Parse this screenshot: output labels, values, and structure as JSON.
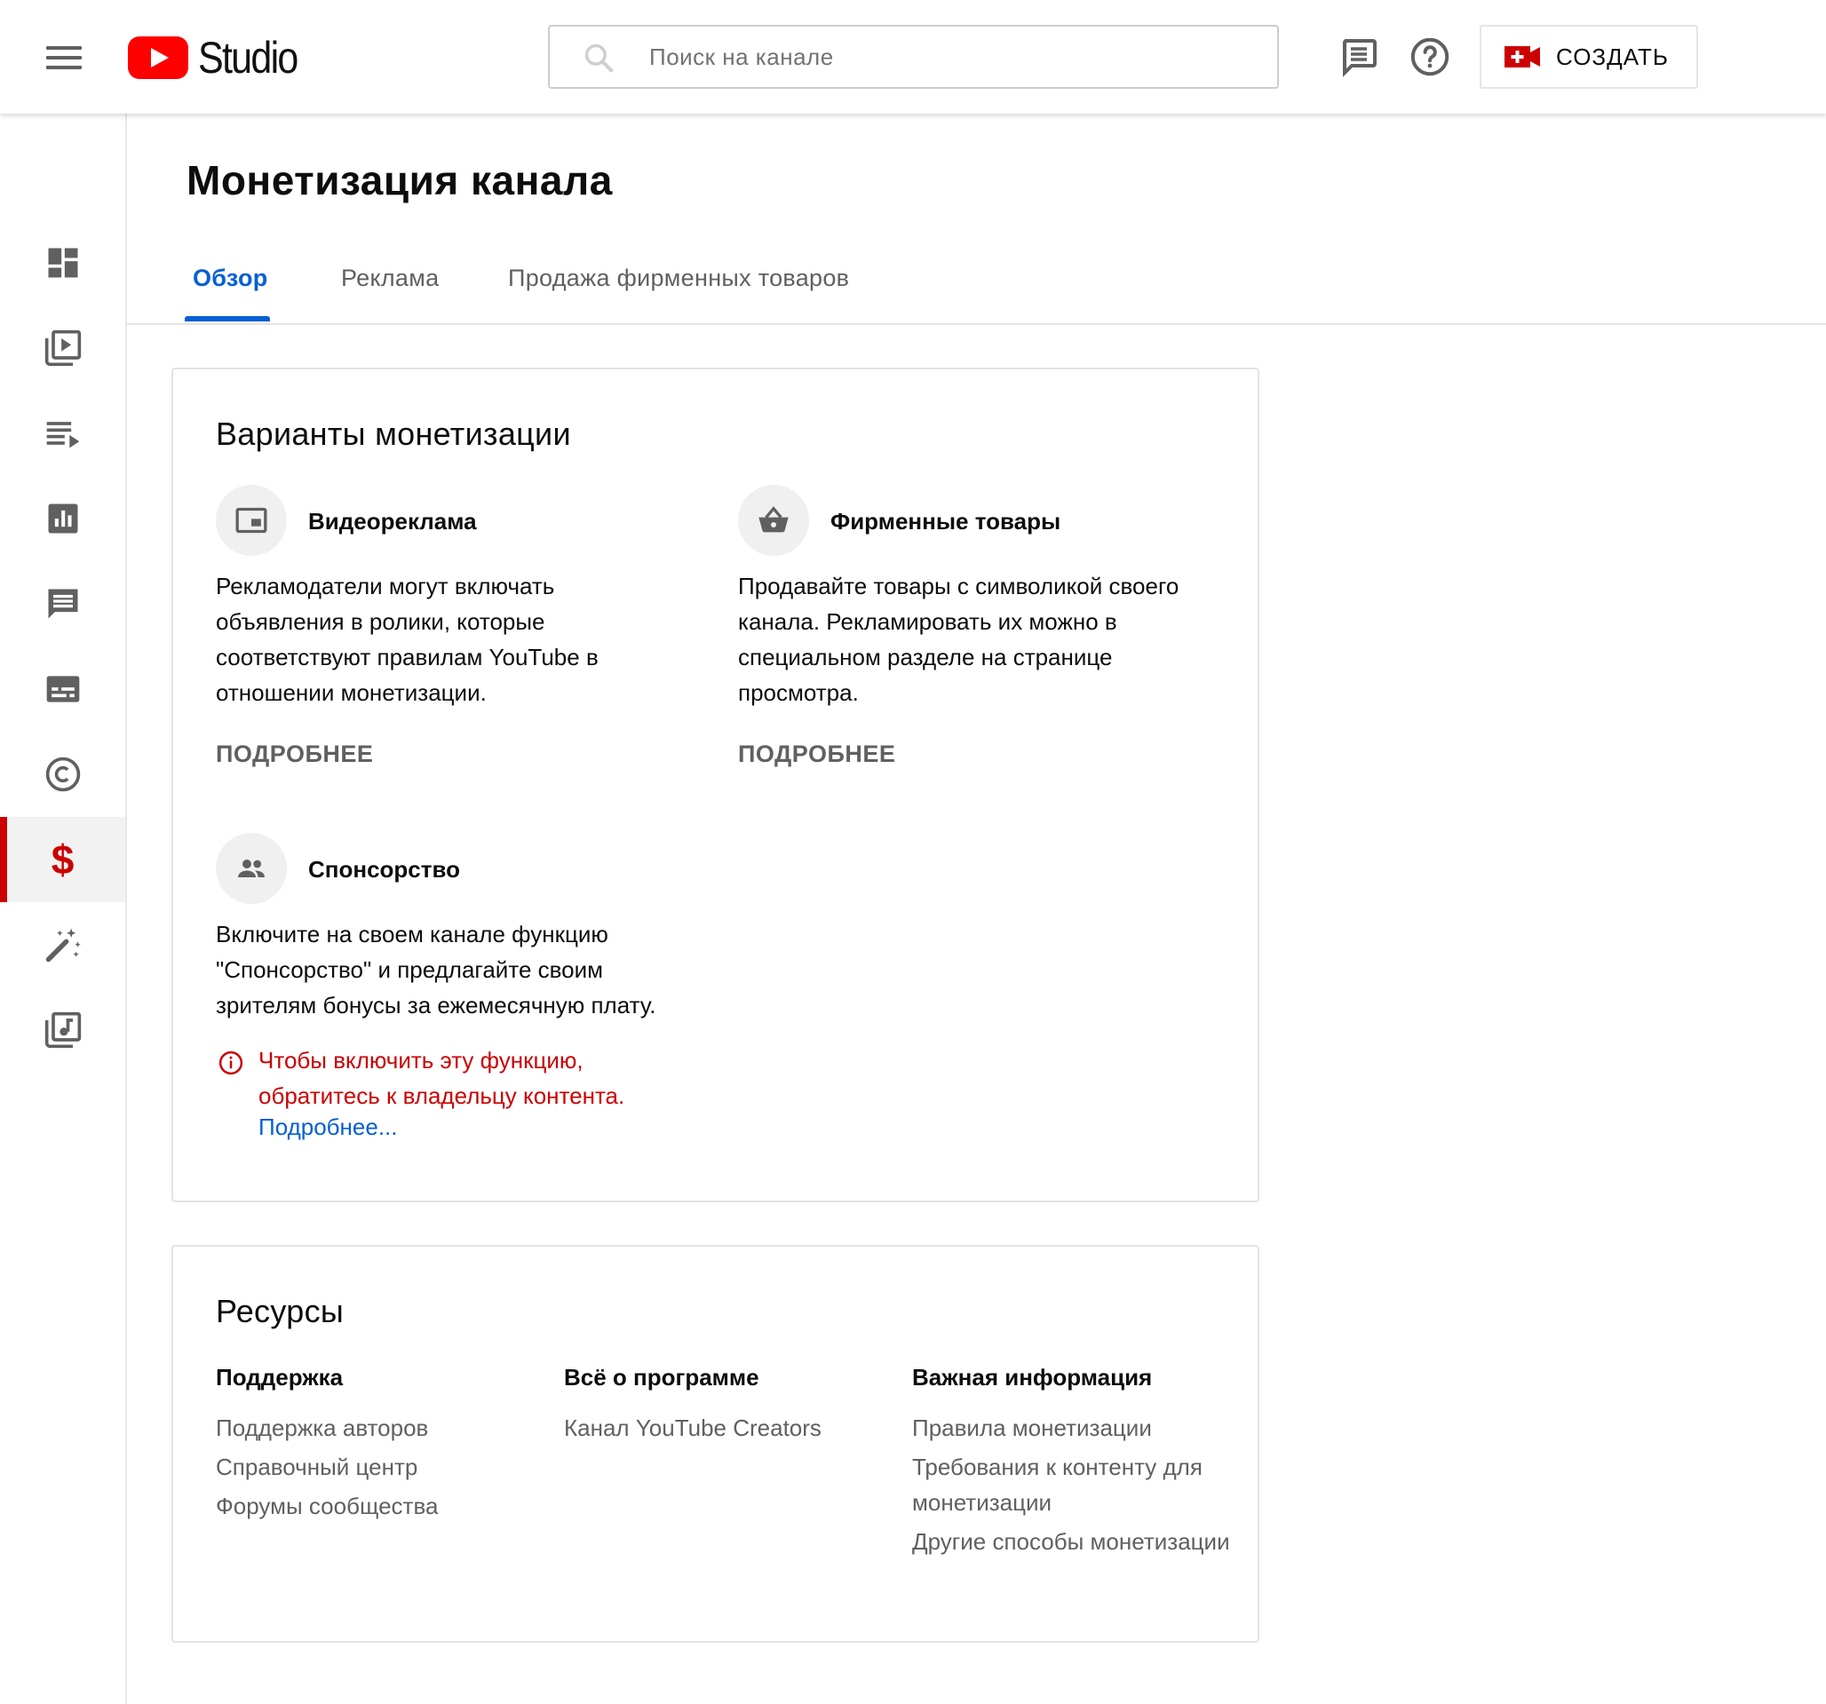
{
  "header": {
    "logo_text": "Studio",
    "search_placeholder": "Поиск на канале",
    "create_label": "СОЗДАТЬ"
  },
  "sidebar": {
    "items": [
      {
        "name": "dashboard-icon"
      },
      {
        "name": "content-icon"
      },
      {
        "name": "playlists-icon"
      },
      {
        "name": "analytics-icon"
      },
      {
        "name": "comments-icon"
      },
      {
        "name": "subtitles-icon"
      },
      {
        "name": "copyright-icon"
      },
      {
        "name": "monetization-icon",
        "label": "$",
        "active": true
      },
      {
        "name": "customization-icon"
      },
      {
        "name": "audio-library-icon"
      }
    ]
  },
  "page": {
    "title": "Монетизация канала",
    "tabs": [
      "Обзор",
      "Реклама",
      "Продажа фирменных товаров"
    ],
    "active_tab": "Обзор"
  },
  "options": {
    "title": "Варианты монетизации",
    "video_ads": {
      "name": "Видеореклама",
      "desc": "Рекламодатели могут включать объявления в ролики, которые соответствуют правилам YouTube в отношении монетизации.",
      "more": "ПОДРОБНЕЕ"
    },
    "merch": {
      "name": "Фирменные товары",
      "desc": "Продавайте товары с символикой своего канала. Рекламировать их можно в специальном разделе на странице просмотра.",
      "more": "ПОДРОБНЕЕ"
    },
    "sponsorship": {
      "name": "Спонсорство",
      "desc": "Включите на своем канале функцию \"Спонсорство\" и предлагайте своим зрителям бонусы за ежемесячную плату.",
      "error": "Чтобы включить эту функцию, обратитесь к владельцу контента.",
      "error_link": "Подробнее..."
    }
  },
  "resources": {
    "title": "Ресурсы",
    "support": {
      "heading": "Поддержка",
      "links": [
        "Поддержка авторов",
        "Справочный центр",
        "Форумы сообщества"
      ]
    },
    "program": {
      "heading": "Всё о программе",
      "links": [
        "Канал YouTube Creators"
      ]
    },
    "important": {
      "heading": "Важная информация",
      "links": [
        "Правила монетизации",
        "Требования к контенту для монетизации",
        "Другие способы монетизации"
      ]
    }
  },
  "colors": {
    "accent_blue": "#065fd4",
    "brand_red": "#ff0000",
    "error_red": "#cc0000"
  }
}
